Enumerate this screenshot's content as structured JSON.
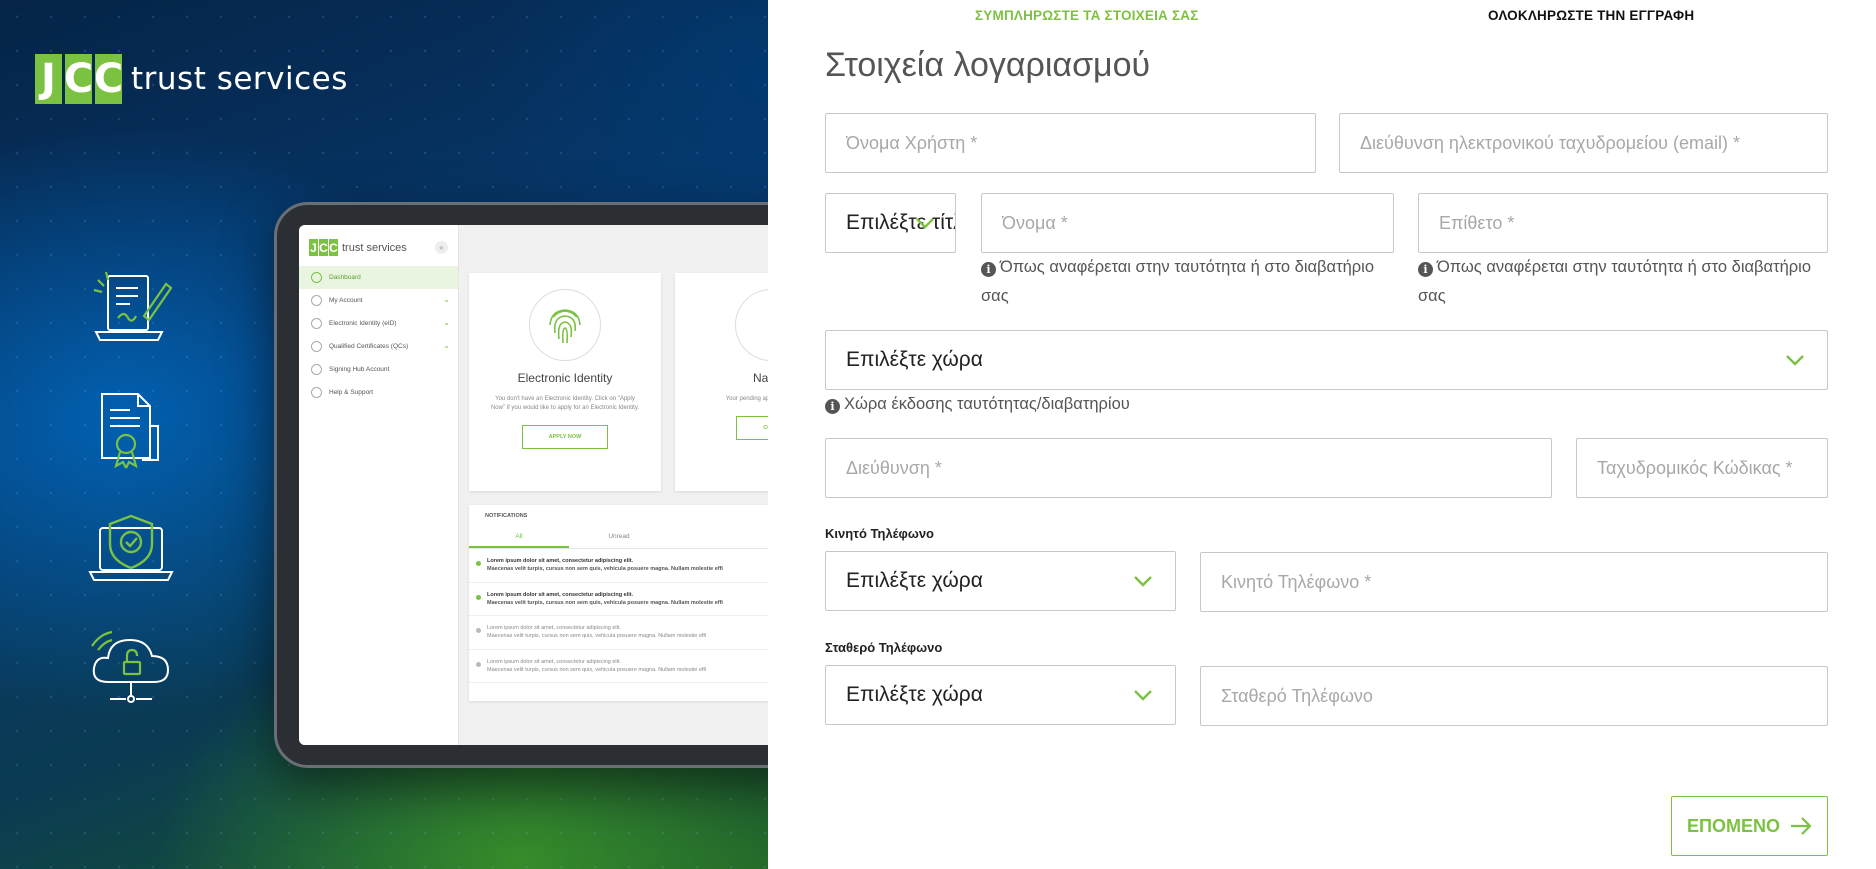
{
  "brand": {
    "logo_letters": [
      "J",
      "C",
      "C"
    ],
    "logo_text": "trust services",
    "accent": "#7cc242"
  },
  "hero_icons": [
    "document-sign-icon",
    "certificate-icon",
    "shield-laptop-icon",
    "cloud-lock-icon"
  ],
  "tablet": {
    "logo_letters": [
      "J",
      "C",
      "C"
    ],
    "logo_text": "trust services",
    "collapse": "«",
    "nav": [
      {
        "label": "Dashboard",
        "active": true,
        "chevron": ""
      },
      {
        "label": "My Account",
        "active": false,
        "chevron": "⌄"
      },
      {
        "label": "Electronic Identity (eID)",
        "active": false,
        "chevron": "⌄"
      },
      {
        "label": "Qualified Certificates (QCs)",
        "active": false,
        "chevron": "⌄"
      },
      {
        "label": "Signing Hub Account",
        "active": false,
        "chevron": ""
      },
      {
        "label": "Help & Support",
        "active": false,
        "chevron": ""
      }
    ],
    "card1": {
      "title": "Electronic Identity",
      "desc": "You don't have an Electronic Identity. Click on \"Apply Now\" if you would like to apply for an Electronic Identity.",
      "button": "APPLY NOW"
    },
    "card2": {
      "title": "Natura",
      "desc": "Your pending appli Please contact",
      "button": "CONT"
    },
    "notifications": {
      "header": "NOTIFICATIONS",
      "tabs": [
        "All",
        "Unread"
      ],
      "rows": [
        {
          "l1": "Lorem ipsum dolor sit amet, consectetur adipiscing elit.",
          "l2": "Maecenas velit turpis, cursus non sem quis, vehicula posuere magna. Nullam molestie effi",
          "read": false
        },
        {
          "l1": "Lorem ipsum dolor sit amet, consectetur adipiscing elit.",
          "l2": "Maecenas velit turpis, cursus non sem quis, vehicula posuere magna. Nullam molestie effi",
          "read": false
        },
        {
          "l1": "Lorem ipsum dolor sit amet, consectetur adipiscing elit.",
          "l2": "Maecenas velit turpis, cursus non sem quis, vehicula posuere magna. Nullam molestie effi",
          "read": true
        },
        {
          "l1": "Lorem ipsum dolor sit amet, consectetur adipiscing elit.",
          "l2": "Maecenas velit turpis, cursus non sem quis, vehicula posuere magna. Nullam molestie effi",
          "read": true
        }
      ]
    }
  },
  "steps": {
    "step1": "ΣΥΜΠΛΗΡΩΣΤΕ ΤΑ ΣΤΟΙΧΕΙΑ ΣΑΣ",
    "step2": "ΟΛΟΚΛΗΡΩΣΤΕ ΤΗΝ ΕΓΓΡΑΦΗ"
  },
  "form": {
    "title": "Στοιχεία λογαριασμού",
    "username": {
      "placeholder": "Όνομα Χρήστη *",
      "value": ""
    },
    "email": {
      "placeholder": "Διεύθυνση ηλεκτρονικού ταχυδρομείου (email) *",
      "value": ""
    },
    "title_select": {
      "value": "Επιλέξτε τίτλο"
    },
    "first_name": {
      "placeholder": "Όνομα *",
      "value": ""
    },
    "last_name": {
      "placeholder": "Επίθετο *",
      "value": ""
    },
    "first_name_hint_l1": "Όπως αναφέρεται στην ταυτότητα ή στο διαβατήριο",
    "first_name_hint_l2": "σας",
    "last_name_hint_l1": "Όπως αναφέρεται στην ταυτότητα ή στο διαβατήριο",
    "last_name_hint_l2": "σας",
    "info_glyph": "i",
    "country_select": {
      "value": "Επιλέξτε χώρα"
    },
    "country_hint": "Χώρα έκδοσης ταυτότητας/διαβατηρίου",
    "address": {
      "placeholder": "Διεύθυνση *",
      "value": ""
    },
    "postal_code": {
      "placeholder": "Ταχυδρομικός Κώδικας *",
      "value": ""
    },
    "mobile_label": "Κινητό Τηλέφωνο",
    "mobile_country": {
      "value": "Επιλέξτε χώρα"
    },
    "mobile": {
      "placeholder": "Κινητό Τηλέφωνο *",
      "value": ""
    },
    "landline_label": "Σταθερό Τηλέφωνο",
    "landline_country": {
      "value": "Επιλέξτε χώρα"
    },
    "landline": {
      "placeholder": "Σταθερό Τηλέφωνο",
      "value": ""
    },
    "next_label": "ΕΠΟΜΕΝΟ"
  }
}
